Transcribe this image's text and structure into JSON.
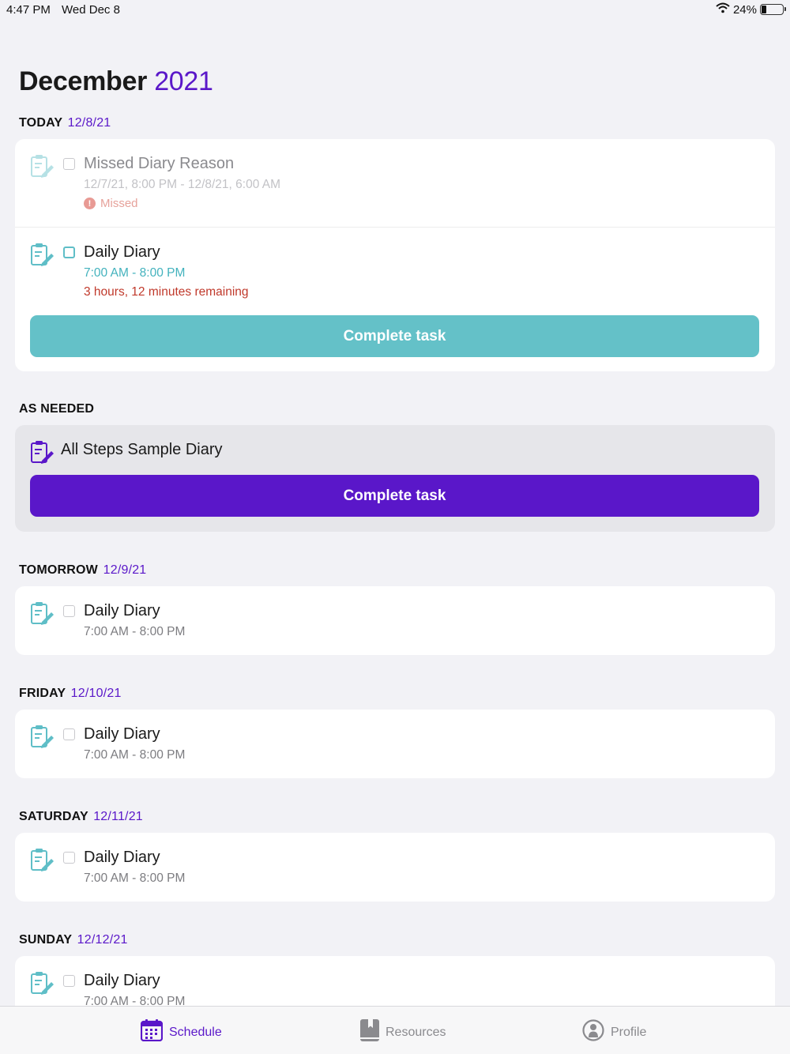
{
  "status": {
    "time": "4:47 PM",
    "date": "Wed Dec 8",
    "battery": "24%",
    "battery_level": 0.24
  },
  "header": {
    "month": "December",
    "year": "2021"
  },
  "sections": {
    "today": {
      "label": "TODAY",
      "date": "12/8/21"
    },
    "as_needed": {
      "label": "AS NEEDED"
    },
    "tomorrow": {
      "label": "TOMORROW",
      "date": "12/9/21"
    },
    "friday": {
      "label": "FRIDAY",
      "date": "12/10/21"
    },
    "saturday": {
      "label": "SATURDAY",
      "date": "12/11/21"
    },
    "sunday": {
      "label": "SUNDAY",
      "date": "12/12/21"
    }
  },
  "today_items": {
    "missed": {
      "title": "Missed Diary Reason",
      "time": "12/7/21, 8:00 PM - 12/8/21, 6:00 AM",
      "status": "Missed"
    },
    "daily": {
      "title": "Daily Diary",
      "time": "7:00 AM - 8:00 PM",
      "remaining": "3 hours, 12 minutes remaining"
    },
    "button": "Complete task"
  },
  "as_needed_item": {
    "title": "All Steps Sample Diary",
    "button": "Complete task"
  },
  "tomorrow_item": {
    "title": "Daily Diary",
    "time": "7:00 AM - 8:00 PM"
  },
  "friday_item": {
    "title": "Daily Diary",
    "time": "7:00 AM - 8:00 PM"
  },
  "saturday_item": {
    "title": "Daily Diary",
    "time": "7:00 AM - 8:00 PM"
  },
  "sunday_item": {
    "title": "Daily Diary",
    "time": "7:00 AM - 8:00 PM"
  },
  "tabs": {
    "schedule": "Schedule",
    "resources": "Resources",
    "profile": "Profile"
  },
  "colors": {
    "accent": "#5a17c9",
    "teal": "#64c1c8",
    "danger": "#c0392b"
  },
  "icons": [
    "wifi-icon",
    "battery-icon",
    "clipboard-edit-icon",
    "calendar-icon",
    "book-icon",
    "profile-icon"
  ]
}
